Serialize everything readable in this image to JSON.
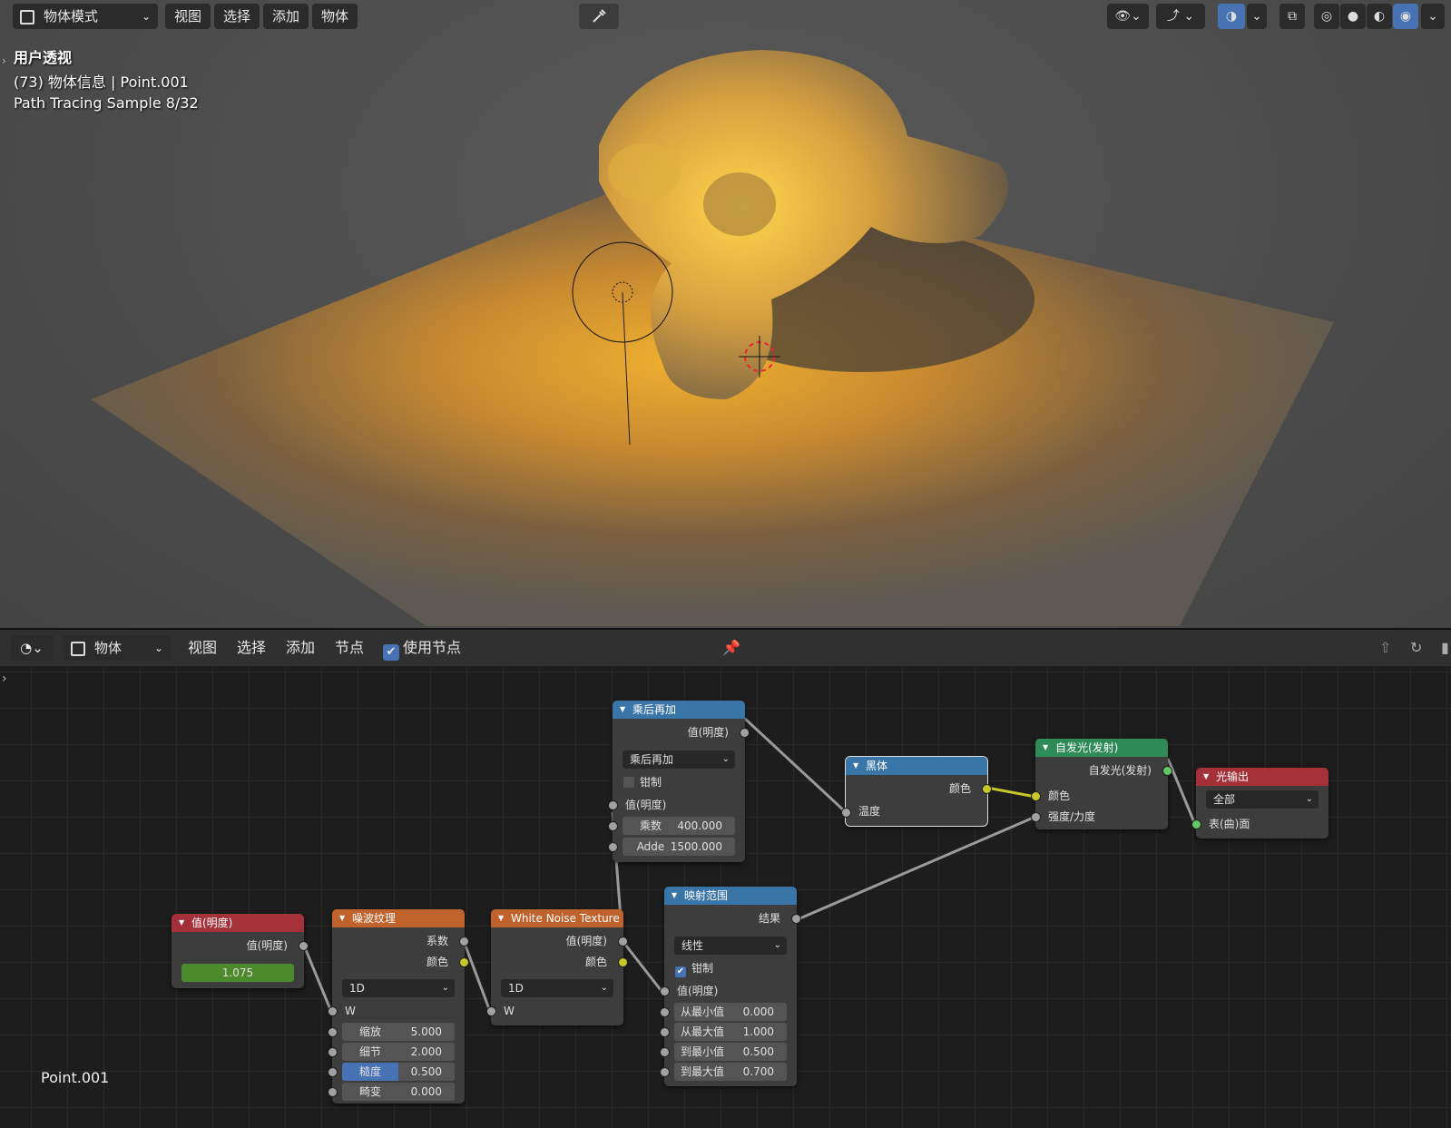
{
  "viewport": {
    "mode": "物体模式",
    "menu": [
      "视图",
      "选择",
      "添加",
      "物体"
    ],
    "overlay": {
      "view_name": "用户透视",
      "object_info": "(73) 物体信息 | Point.001",
      "render_progress": "Path Tracing Sample 8/32"
    }
  },
  "node_editor": {
    "editor_type": "物体",
    "menu": [
      "视图",
      "选择",
      "添加",
      "节点"
    ],
    "use_nodes_label": "使用节点",
    "use_nodes_checked": true,
    "object_name": "Point.001",
    "nodes": {
      "value": {
        "title": "值(明度)",
        "output": "值(明度)",
        "value": "1.075",
        "color": "#a4303a"
      },
      "noise": {
        "title": "噪波纹理",
        "outputs": [
          "系数",
          "颜色"
        ],
        "dimension": "1D",
        "input_w": "W",
        "fields": [
          {
            "label": "缩放",
            "value": "5.000"
          },
          {
            "label": "细节",
            "value": "2.000"
          },
          {
            "label": "糙度",
            "value": "0.500"
          },
          {
            "label": "畸变",
            "value": "0.000"
          }
        ],
        "color": "#c0622b"
      },
      "white_noise": {
        "title": "White Noise Texture",
        "outputs": [
          "值(明度)",
          "颜色"
        ],
        "dimension": "1D",
        "input_w": "W",
        "color": "#c0622b"
      },
      "multiply_add": {
        "title": "乘后再加",
        "output": "值(明度)",
        "operation": "乘后再加",
        "clamp_label": "钳制",
        "clamp": false,
        "input_value": "值(明度)",
        "fields": [
          {
            "label": "乘数",
            "value": "400.000"
          },
          {
            "label": "Adde",
            "value": "1500.000"
          }
        ],
        "color": "#3a75a8"
      },
      "blackbody": {
        "title": "黑体",
        "output": "颜色",
        "input": "温度",
        "color": "#3a75a8"
      },
      "map_range": {
        "title": "映射范围",
        "output": "结果",
        "interpolation": "线性",
        "clamp_label": "钳制",
        "clamp": true,
        "input_value": "值(明度)",
        "fields": [
          {
            "label": "从最小值",
            "value": "0.000"
          },
          {
            "label": "从最大值",
            "value": "1.000"
          },
          {
            "label": "到最小值",
            "value": "0.500"
          },
          {
            "label": "到最大值",
            "value": "0.700"
          }
        ],
        "color": "#3a75a8"
      },
      "emission": {
        "title": "自发光(发射)",
        "output": "自发光(发射)",
        "inputs": [
          "颜色",
          "强度/力度"
        ],
        "color": "#2e8b57"
      },
      "light_output": {
        "title": "光输出",
        "target": "全部",
        "input": "表(曲)面",
        "color": "#a4303a"
      }
    }
  }
}
